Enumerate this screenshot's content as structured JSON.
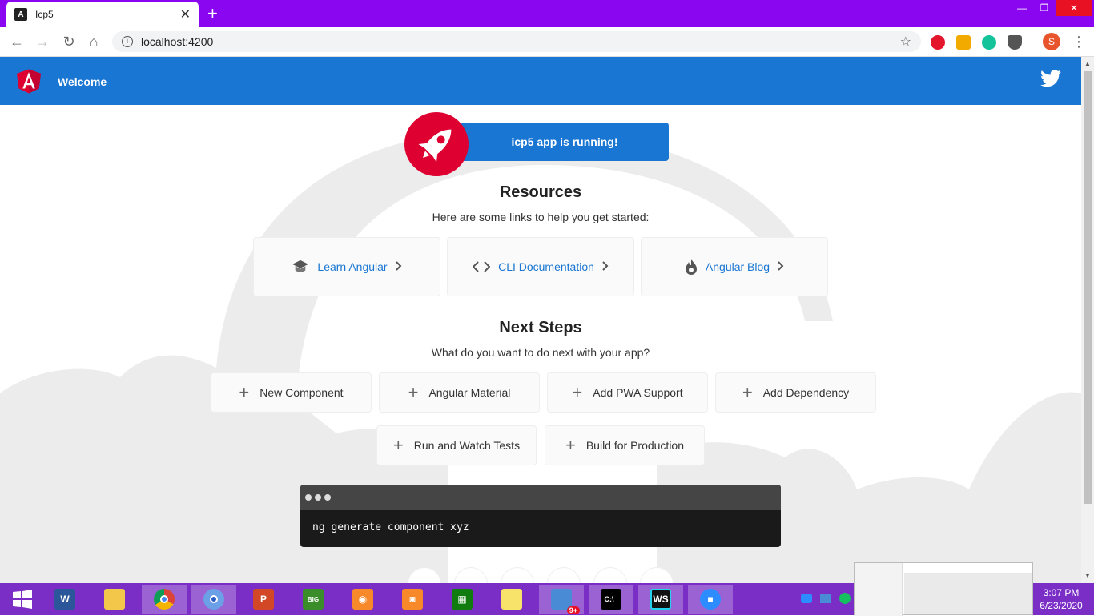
{
  "browser": {
    "tab_title": "Icp5",
    "tab_favicon": "angular-icon",
    "url": "localhost:4200",
    "window_controls": [
      "minimize",
      "restore",
      "close"
    ]
  },
  "app": {
    "toolbar_title": "Welcome",
    "running_text": "icp5 app is running!",
    "resources": {
      "title": "Resources",
      "subtitle": "Here are some links to help you get started:",
      "links": [
        {
          "label": "Learn Angular",
          "icon": "graduation-cap-icon"
        },
        {
          "label": "CLI Documentation",
          "icon": "code-brackets-icon"
        },
        {
          "label": "Angular Blog",
          "icon": "flame-icon"
        }
      ]
    },
    "next_steps": {
      "title": "Next Steps",
      "subtitle": "What do you want to do next with your app?",
      "row1": [
        "New Component",
        "Angular Material",
        "Add PWA Support",
        "Add Dependency"
      ],
      "row2": [
        "Run and Watch Tests",
        "Build for Production"
      ]
    },
    "terminal_command": "ng generate component xyz"
  },
  "taskbar": {
    "time": "3:07 PM",
    "date": "6/23/2020",
    "badge": "9+"
  },
  "colors": {
    "chrome_purple": "#8a06f0",
    "angular_blue": "#1976d2",
    "angular_red": "#dd0031",
    "taskbar_purple": "#7a2ec6"
  }
}
